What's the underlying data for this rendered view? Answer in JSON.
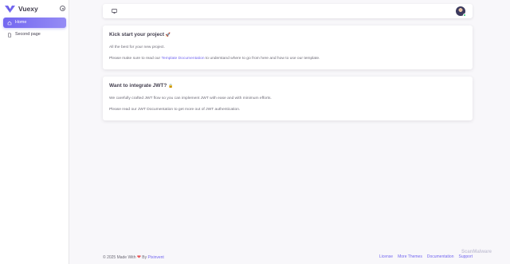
{
  "brand": {
    "name": "Vuexy",
    "color": "#7367f0"
  },
  "sidebar": {
    "items": [
      {
        "label": "Home",
        "icon": "home-icon",
        "active": true
      },
      {
        "label": "Second page",
        "icon": "file-icon",
        "active": false
      }
    ]
  },
  "navbar": {
    "icon": "monitor-icon",
    "avatar": "avatar"
  },
  "cards": [
    {
      "title": "Kick start your project",
      "emoji": "🚀",
      "text1": "All the best for your new project.",
      "text2_prefix": "Please make sure to read our ",
      "text2_link": "Template Documentation",
      "text2_suffix": " to understand where to go from here and how to use our template."
    },
    {
      "title": "Want to integrate JWT?",
      "emoji": "🔒",
      "text1": "We carefully crafted JWT flow so you can implement JWT with ease and with minimum efforts.",
      "text2": "Please read our JWT Documentation to get more out of JWT authentication."
    }
  ],
  "footer": {
    "copyright_prefix": "© 2025 Made With ",
    "heart": "❤",
    "by": " By ",
    "author": "Pixinvent",
    "links": [
      "License",
      "More Themes",
      "Documentation",
      "Support"
    ]
  },
  "watermark": "ScanMalware"
}
